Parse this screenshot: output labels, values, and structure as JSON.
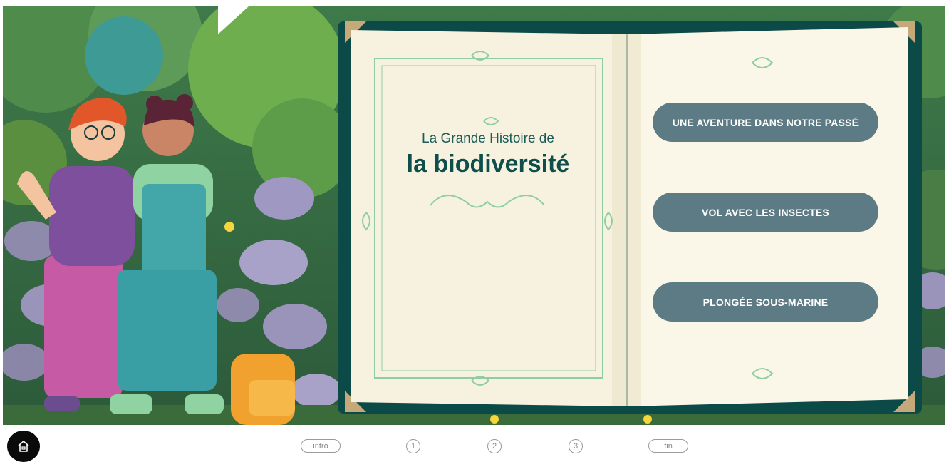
{
  "book": {
    "title_small": "La Grande Histoire de",
    "title_big": "la biodiversité"
  },
  "chapters": [
    {
      "label": "UNE AVENTURE DANS NOTRE PASSÉ"
    },
    {
      "label": "VOL AVEC LES INSECTES"
    },
    {
      "label": "PLONGÉE SOUS-MARINE"
    }
  ],
  "progress": {
    "steps": [
      "intro",
      "1",
      "2",
      "3",
      "fin"
    ]
  },
  "icons": {
    "home": "home-icon"
  },
  "colors": {
    "button": "#5d7b85",
    "book_cover": "#0c4a48",
    "page": "#f7f2e0",
    "ornament": "#8fcf9f",
    "title": "#0f4f4b"
  }
}
